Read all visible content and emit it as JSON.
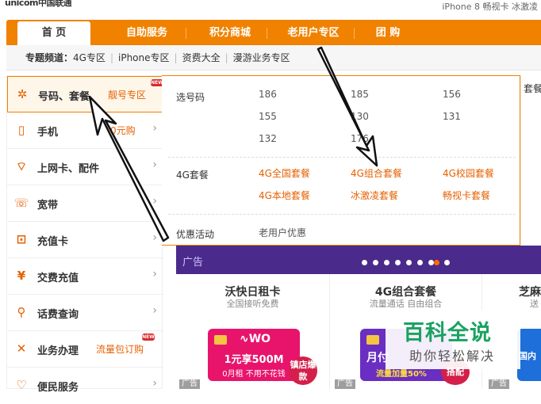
{
  "header": {
    "logo": "unicom中国联通",
    "top_right": "iPhone 8 畅视卡 冰激凌"
  },
  "nav": {
    "items": [
      "首 页",
      "自助服务",
      "积分商城",
      "老用户专区",
      "团 购"
    ]
  },
  "topic": {
    "label": "专题频道：",
    "links": [
      "4G专区",
      "iPhone专区",
      "资费大全",
      "漫游业务专区"
    ]
  },
  "sidebar": {
    "items": [
      {
        "label": "号码、套餐",
        "promo": "靓号专区",
        "icon": "gear-icon",
        "badge": "NEW"
      },
      {
        "label": "手机",
        "promo": "0元购",
        "icon": "phone-icon"
      },
      {
        "label": "上网卡、配件",
        "promo": "",
        "icon": "signal-icon"
      },
      {
        "label": "宽带",
        "promo": "",
        "icon": "broadband-icon"
      },
      {
        "label": "充值卡",
        "promo": "",
        "icon": "recharge-card-icon"
      },
      {
        "label": "交费充值",
        "promo": "",
        "icon": "yen-icon"
      },
      {
        "label": "话费查询",
        "promo": "",
        "icon": "search-icon"
      },
      {
        "label": "业务办理",
        "promo": "流量包订购",
        "icon": "tools-icon",
        "badge": "NEW"
      },
      {
        "label": "便民服务",
        "promo": "",
        "icon": "heart-icon"
      }
    ]
  },
  "panel": {
    "number_label": "选号码",
    "numbers": [
      "186",
      "185",
      "156",
      "155",
      "130",
      "131",
      "132",
      "176"
    ],
    "plans_label": "4G套餐",
    "plans": [
      "4G全国套餐",
      "4G组合套餐",
      "4G校园套餐",
      "4G本地套餐",
      "冰激凌套餐",
      "畅视卡套餐"
    ],
    "promo_label": "优惠活动",
    "promo_item": "老用户优惠"
  },
  "right_col": {
    "label": "套餐"
  },
  "banner": {
    "ad_label": "广告"
  },
  "cards": [
    {
      "title": "沃快日租卡",
      "subtitle": "全国接听免费",
      "promo_main": "1元享500M",
      "promo_sub": "0月租 不用不花钱",
      "sticker": "镇店爆款",
      "ad": "广告"
    },
    {
      "title": "4G组合套餐",
      "subtitle": "流量通话 自由组合",
      "promo_main": "月付",
      "promo_sub": "流量加量50%",
      "sticker": "搭配",
      "ad": "广告"
    },
    {
      "title": "芝麻",
      "subtitle": "送",
      "promo_main": "国内",
      "ad": "广告"
    }
  ],
  "watermark": {
    "title": "百科全说",
    "subtitle": "助你轻松解决"
  },
  "colors": {
    "brand_orange": "#f08200",
    "accent_orange": "#e56000",
    "banner_purple": "#4a2a8a",
    "card_pink": "#e8146c"
  }
}
